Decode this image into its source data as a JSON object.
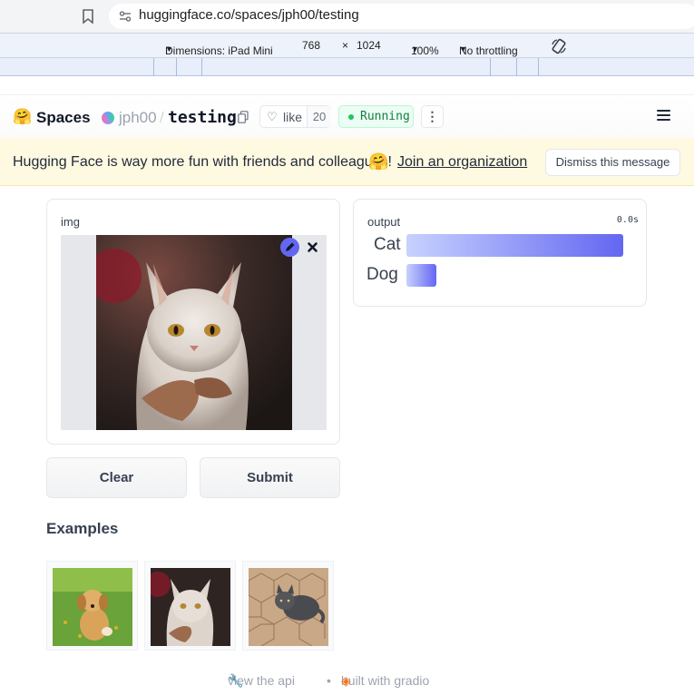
{
  "browser": {
    "url": "huggingface.co/spaces/jph00/testing"
  },
  "devtools": {
    "dimensions_label": "Dimensions: iPad Mini",
    "width": "768",
    "times": "×",
    "height": "1024",
    "zoom": "100%",
    "throttling": "No throttling"
  },
  "header": {
    "logo_emoji": "🤗",
    "spaces_label": "Spaces",
    "owner": "jph00",
    "separator": "/",
    "repo": "testing",
    "like_label": "like",
    "like_count": "20",
    "status": "Running",
    "more_glyph": "⋮"
  },
  "banner": {
    "message": "Hugging Face is way more fun with friends and colleagues!",
    "emoji": "🤗",
    "join_link": "Join an organization",
    "dismiss_label": "Dismiss this message"
  },
  "app": {
    "input_label": "img",
    "output_label": "output",
    "elapsed": "0.0s",
    "predictions": [
      {
        "label": "Cat",
        "confidence": 1.0
      },
      {
        "label": "Dog",
        "confidence": 0.14
      }
    ],
    "clear_label": "Clear",
    "submit_label": "Submit",
    "examples_title": "Examples",
    "examples": [
      "puppy on grass",
      "cat with scarf",
      "grey kitten on pavement"
    ]
  },
  "footer": {
    "api_label": "view the api",
    "bullet": "•",
    "built_label": "built with gradio"
  },
  "colors": {
    "accent": "#6366f1",
    "banner_bg": "#fef9e1",
    "running_green": "#22c55e"
  }
}
